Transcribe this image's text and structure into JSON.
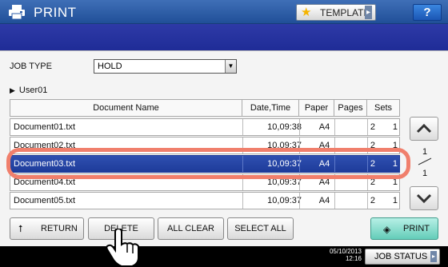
{
  "header": {
    "title": "PRINT",
    "template_label": "TEMPLATE",
    "help_label": "?"
  },
  "job_type": {
    "label": "JOB TYPE",
    "selected": "HOLD"
  },
  "user": "User01",
  "table": {
    "columns": [
      "Document Name",
      "Date,Time",
      "Paper",
      "Pages",
      "Sets"
    ],
    "rows": [
      {
        "name": "Document01.txt",
        "datetime": "10,09:38",
        "paper": "A4",
        "pages": "2",
        "sets": "1",
        "selected": false
      },
      {
        "name": "Document02.txt",
        "datetime": "10,09:37",
        "paper": "A4",
        "pages": "2",
        "sets": "1",
        "selected": false
      },
      {
        "name": "Document03.txt",
        "datetime": "10,09:37",
        "paper": "A4",
        "pages": "2",
        "sets": "1",
        "selected": true
      },
      {
        "name": "Document04.txt",
        "datetime": "10,09:37",
        "paper": "A4",
        "pages": "2",
        "sets": "1",
        "selected": false
      },
      {
        "name": "Document05.txt",
        "datetime": "10,09:37",
        "paper": "A4",
        "pages": "2",
        "sets": "1",
        "selected": false
      }
    ]
  },
  "pager": {
    "current": "1",
    "total": "1"
  },
  "buttons": {
    "return": "RETURN",
    "delete": "DELETE",
    "all_clear": "ALL CLEAR",
    "select_all": "SELECT ALL",
    "print": "PRINT"
  },
  "status": {
    "date": "05/10/2013",
    "time": "12:16",
    "job_status": "JOB STATUS"
  },
  "colors": {
    "title_bar": "#2d5da8",
    "selected_row": "#1e3c9a",
    "highlight_ring": "#f07f6c",
    "print_button": "#64cdb9"
  }
}
